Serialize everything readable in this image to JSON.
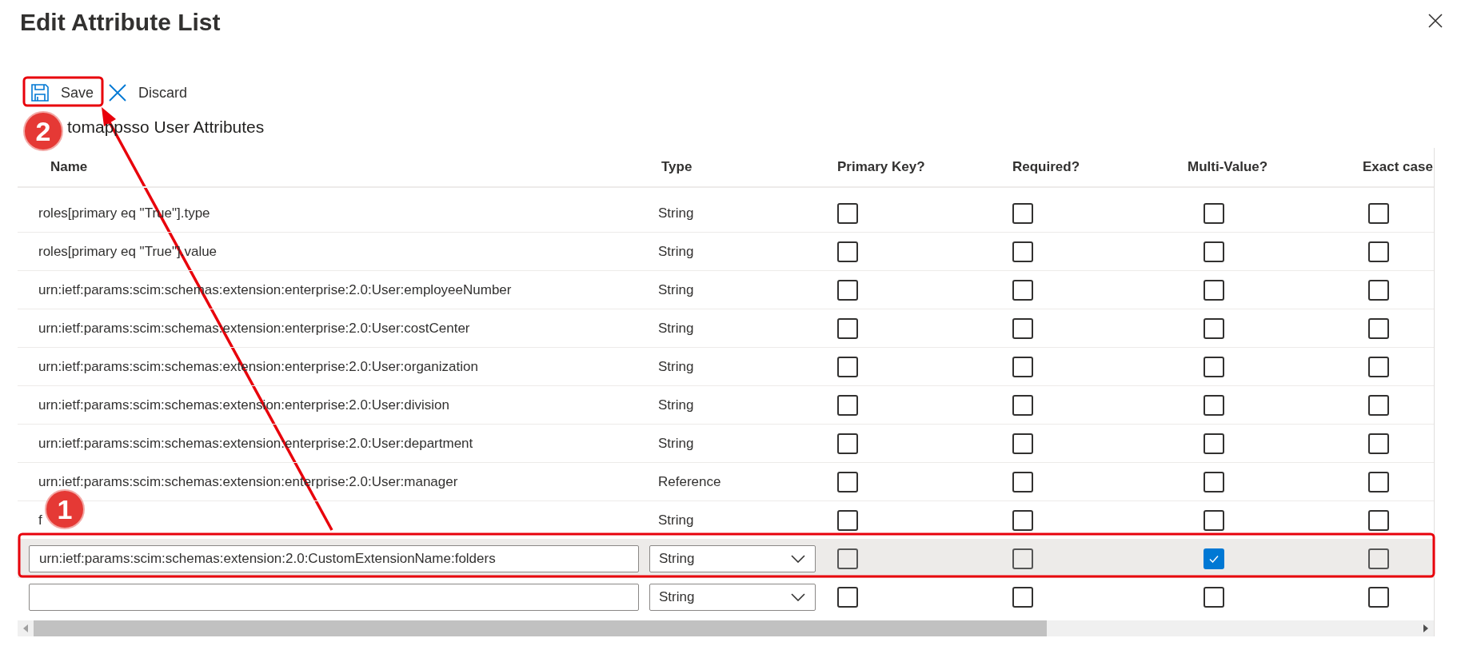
{
  "window": {
    "title": "Edit Attribute List"
  },
  "toolbar": [
    {
      "kind": "save",
      "label": "Save"
    },
    {
      "kind": "discard",
      "label": "Discard"
    }
  ],
  "section_title": "tomappsso User Attributes",
  "table": {
    "columns": [
      "Name",
      "Type",
      "Primary Key?",
      "Required?",
      "Multi-Value?",
      "Exact case"
    ],
    "rows": [
      {
        "kind": "static",
        "name": "roles[primary eq \"True\"].type",
        "type": "String",
        "checks": [
          false,
          false,
          false,
          false
        ]
      },
      {
        "kind": "static",
        "name": "roles[primary eq \"True\"].value",
        "type": "String",
        "checks": [
          false,
          false,
          false,
          false
        ]
      },
      {
        "kind": "static",
        "name": "urn:ietf:params:scim:schemas:extension:enterprise:2.0:User:employeeNumber",
        "type": "String",
        "checks": [
          false,
          false,
          false,
          false
        ]
      },
      {
        "kind": "static",
        "name": "urn:ietf:params:scim:schemas:extension:enterprise:2.0:User:costCenter",
        "type": "String",
        "checks": [
          false,
          false,
          false,
          false
        ]
      },
      {
        "kind": "static",
        "name": "urn:ietf:params:scim:schemas:extension:enterprise:2.0:User:organization",
        "type": "String",
        "checks": [
          false,
          false,
          false,
          false
        ]
      },
      {
        "kind": "static",
        "name": "urn:ietf:params:scim:schemas:extension:enterprise:2.0:User:division",
        "type": "String",
        "checks": [
          false,
          false,
          false,
          false
        ]
      },
      {
        "kind": "static",
        "name": "urn:ietf:params:scim:schemas:extension:enterprise:2.0:User:department",
        "type": "String",
        "checks": [
          false,
          false,
          false,
          false
        ]
      },
      {
        "kind": "static",
        "name": "urn:ietf:params:scim:schemas:extension:enterprise:2.0:User:manager",
        "type": "Reference",
        "checks": [
          false,
          false,
          false,
          false
        ]
      },
      {
        "kind": "static",
        "name": "f",
        "type": "String",
        "checks": [
          false,
          false,
          false,
          false
        ]
      },
      {
        "kind": "edit",
        "name": "urn:ietf:params:scim:schemas:extension:2.0:CustomExtensionName:folders",
        "type": "String",
        "checks": [
          false,
          false,
          true,
          false
        ]
      },
      {
        "kind": "new",
        "type": "String",
        "checks": [
          false,
          false,
          false,
          false
        ]
      }
    ]
  },
  "annotations": [
    {
      "label": "1"
    },
    {
      "label": "2"
    }
  ]
}
